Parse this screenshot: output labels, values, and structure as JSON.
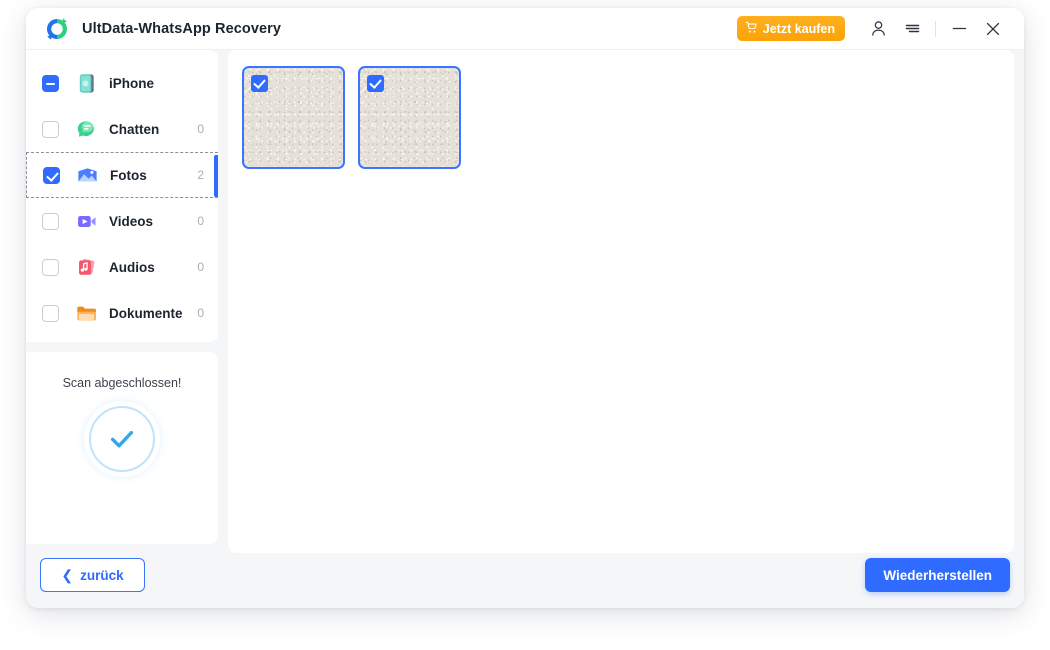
{
  "app": {
    "title": "UltData-WhatsApp Recovery",
    "logo_icon": "refresh-circle-logo",
    "accent_color": "#2f6bff",
    "buy_color": "#fba208"
  },
  "titlebar": {
    "buy_label": "Jetzt kaufen",
    "buy_icon": "cart-icon",
    "account_icon": "user-icon",
    "menu_icon": "hamburger-menu-icon",
    "minimize_icon": "minimize-icon",
    "close_icon": "close-icon"
  },
  "sidebar": {
    "items": [
      {
        "label": "iPhone",
        "count": "",
        "icon": "iphone-device-icon",
        "checkbox": "indeterminate",
        "selected": false
      },
      {
        "label": "Chatten",
        "count": "0",
        "icon": "chat-bubble-icon",
        "checkbox": "unchecked",
        "selected": false
      },
      {
        "label": "Fotos",
        "count": "2",
        "icon": "photo-icon",
        "checkbox": "checked",
        "selected": true
      },
      {
        "label": "Videos",
        "count": "0",
        "icon": "video-icon",
        "checkbox": "unchecked",
        "selected": false
      },
      {
        "label": "Audios",
        "count": "0",
        "icon": "music-icon",
        "checkbox": "unchecked",
        "selected": false
      },
      {
        "label": "Dokumente",
        "count": "0",
        "icon": "folder-icon",
        "checkbox": "unchecked",
        "selected": false
      }
    ],
    "scan": {
      "status_text": "Scan abgeschlossen!",
      "icon": "check-circle-icon"
    }
  },
  "main": {
    "thumbnails": [
      {
        "selected": true
      },
      {
        "selected": true
      }
    ]
  },
  "footer": {
    "back_label": "zurück",
    "back_icon": "chevron-left-icon",
    "recover_label": "Wiederherstellen"
  }
}
